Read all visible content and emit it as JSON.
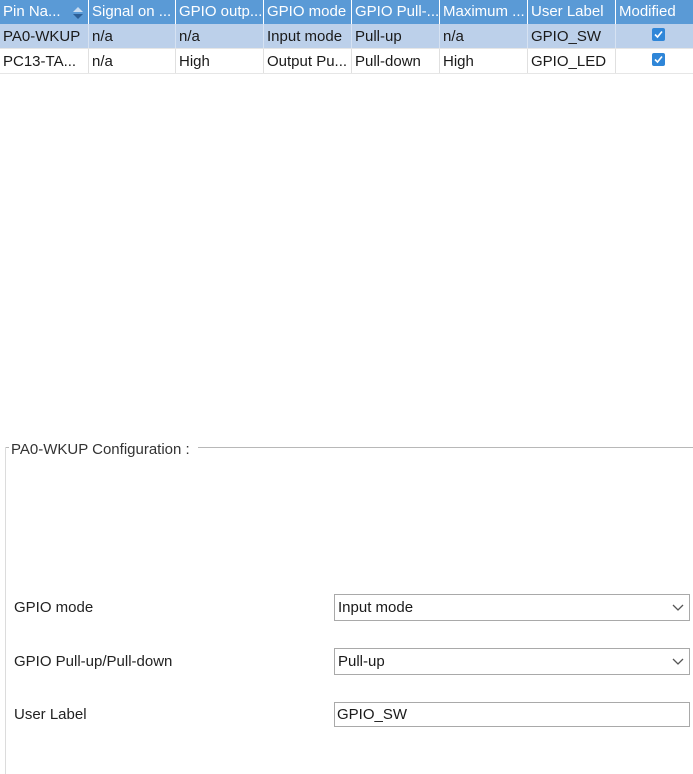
{
  "table": {
    "headers": [
      "Pin Na...",
      "Signal on ...",
      "GPIO outp...",
      "GPIO mode",
      "GPIO Pull-...",
      "Maximum ...",
      "User Label",
      "Modified"
    ],
    "rows": [
      {
        "cells": [
          "PA0-WKUP",
          "n/a",
          "n/a",
          "Input mode",
          "Pull-up",
          "n/a",
          "GPIO_SW"
        ],
        "modified": true,
        "selected": true
      },
      {
        "cells": [
          "PC13-TA...",
          "n/a",
          "High",
          "Output Pu...",
          "Pull-down",
          "High",
          "GPIO_LED"
        ],
        "modified": true,
        "selected": false
      }
    ]
  },
  "config": {
    "title": "PA0-WKUP Configuration :",
    "gpio_mode_label": "GPIO mode",
    "gpio_mode_value": "Input mode",
    "pull_label": "GPIO Pull-up/Pull-down",
    "pull_value": "Pull-up",
    "user_label_label": "User Label",
    "user_label_value": "GPIO_SW"
  },
  "icons": {
    "sort": "sort-arrows-icon",
    "check": "checkbox-checked-icon",
    "dropdown": "chevron-down-icon"
  },
  "colors": {
    "header_bg": "#5a9ad6",
    "selected_row_bg": "#bcd0ea",
    "checkbox": "#2f86d8"
  }
}
